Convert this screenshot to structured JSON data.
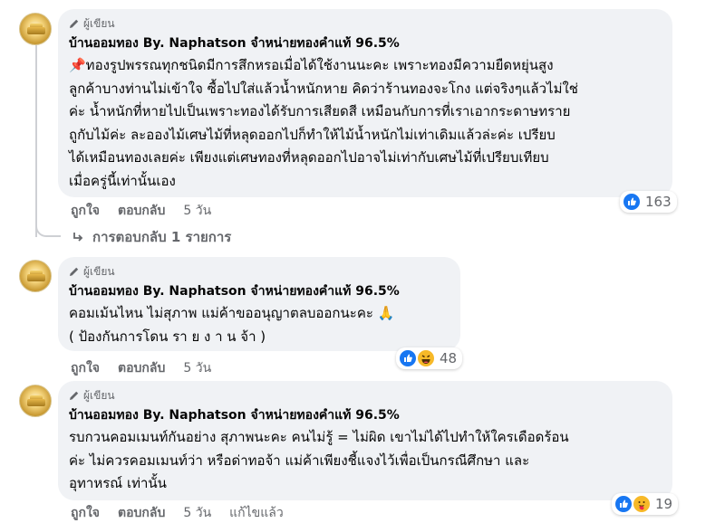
{
  "comments": [
    {
      "badge": "ผู้เขียน",
      "author": "บ้านออมทอง By. Naphatson จำหน่ายทองคำแท้ 96.5%",
      "text": "📌ทองรูปพรรณทุกชนิดมีการสึกหรอเมื่อได้ใช้งานนะคะ เพราะทองมีความยืดหยุ่นสูง\nลูกค้าบางท่านไม่เข้าใจ ซื้อไปใส่แล้วน้ำหนักหาย คิดว่าร้านทองจะโกง แต่จริงๆแล้วไม่ใช่\nค่ะ น้ำหนักที่หายไปเป็นเพราะทองได้รับการเสียดสี เหมือนกับการที่เราเอากระดาษทราย\nถูกับไม้ค่ะ ละอองไม้เศษไม้ที่หลุดออกไปก็ทำให้ไม้น้ำหนักไม่เท่าเดิมแล้วล่ะค่ะ เปรียบ\nได้เหมือนทองเลยค่ะ เพียงแต่เศษทองที่หลุดออกไปอาจไม่เท่ากับเศษไม้ที่เปรียบเทียบ\nเมื่อครู่นี้เท่านั้นเอง",
      "reaction_count": "163",
      "like": "ถูกใจ",
      "reply": "ตอบกลับ",
      "time": "5 วัน"
    },
    {
      "badge": "ผู้เขียน",
      "author": "บ้านออมทอง By. Naphatson จำหน่ายทองคำแท้ 96.5%",
      "text": "คอมเม้นไหน ไม่สุภาพ แม่ค้าขออนุญาตลบออกนะคะ 🙏\n( ป้องกันการโดน รา ย ง า น จ้า )",
      "reaction_count": "48",
      "like": "ถูกใจ",
      "reply": "ตอบกลับ",
      "time": "5 วัน"
    },
    {
      "badge": "ผู้เขียน",
      "author": "บ้านออมทอง By. Naphatson จำหน่ายทองคำแท้ 96.5%",
      "text": "รบกวนคอมเมนท์กันอย่าง สุภาพนะคะ คนไม่รู้ = ไม่ผิด เขาไม่ได้ไปทำให้ใครเดือดร้อน\nค่ะ ไม่ควรคอมเมนท์ว่า หรือด่าทอจ้า แม่ค้าเพียงชี้แจงไว้เพื่อเป็นกรณีศึกษา และ\nอุทาหรณ์ เท่านั้น",
      "reaction_count": "19",
      "like": "ถูกใจ",
      "reply": "ตอบกลับ",
      "time": "5 วัน",
      "edited": "แก้ไขแล้ว"
    }
  ],
  "replies_link": "การตอบกลับ 1 รายการ",
  "colors": {
    "bubble": "#f0f2f5",
    "secondary_text": "#65676b",
    "like_blue": "#1877f2",
    "haha_yellow": "#f7b928"
  }
}
